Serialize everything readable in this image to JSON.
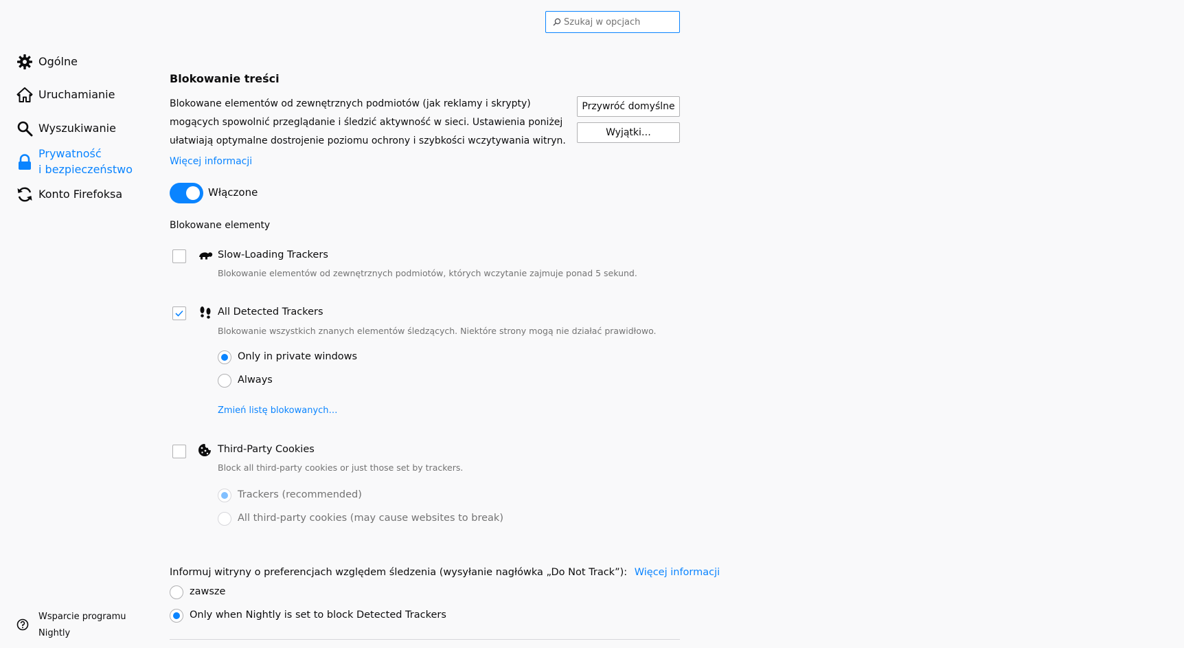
{
  "search": {
    "placeholder": "Szukaj w opcjach"
  },
  "sidebar": {
    "items": [
      {
        "label": "Ogólne",
        "icon": "gear-icon"
      },
      {
        "label": "Uruchamianie",
        "icon": "home-icon"
      },
      {
        "label": "Wyszukiwanie",
        "icon": "search-icon"
      },
      {
        "label_line1": "Prywatność",
        "label_line2": "i bezpieczeństwo",
        "icon": "lock-icon",
        "active": true
      },
      {
        "label": "Konto Firefoksa",
        "icon": "sync-icon"
      }
    ],
    "support": {
      "line1": "Wsparcie programu",
      "line2": "Nightly",
      "icon": "help-icon"
    }
  },
  "content_blocking": {
    "title": "Blokowanie treści",
    "description": "Blokowane elementów od zewnętrznych podmiotów (jak reklamy i skrypty) mogących spowolnić przeglądanie i śledzić aktywność w sieci. Ustawienia poniżej ułatwiają optymalne dostrojenie poziomu ochrony i szybkości wczytywania witryn.",
    "learn_more": "Więcej informacji",
    "restore_defaults": "Przywróć domyślne",
    "exceptions": "Wyjątki…",
    "toggle_label": "Włączone",
    "toggle_on": true,
    "blocked_label": "Blokowane elementy",
    "slow_trackers": {
      "title": "Slow-Loading Trackers",
      "subtitle": "Blokowanie elementów od zewnętrznych podmiotów, których wczytanie zajmuje ponad 5 sekund.",
      "checked": false,
      "icon": "turtle-icon"
    },
    "all_trackers": {
      "title": "All Detected Trackers",
      "subtitle": "Blokowanie wszystkich znanych elementów śledzących. Niektóre strony mogą nie działać prawidłowo.",
      "checked": true,
      "icon": "footprints-icon",
      "options": [
        "Only in private windows",
        "Always"
      ],
      "selected": 0,
      "change_list": "Zmień listę blokowanych…"
    },
    "third_party_cookies": {
      "title": "Third-Party Cookies",
      "subtitle": "Block all third-party cookies or just those set by trackers.",
      "checked": false,
      "icon": "cookie-icon",
      "options": [
        "Trackers (recommended)",
        "All third-party cookies (may cause websites to break)"
      ],
      "selected": 0
    }
  },
  "dnt": {
    "label": "Informuj witryny o preferencjach względem śledzenia (wysyłanie nagłówka „Do Not Track”):",
    "learn_more": "Więcej informacji",
    "options": [
      "zawsze",
      "Only when Nightly is set to block Detected Trackers"
    ],
    "selected": 1
  },
  "colors": {
    "accent": "#0a84ff",
    "background": "#f9f9fa",
    "muted": "#737373"
  }
}
